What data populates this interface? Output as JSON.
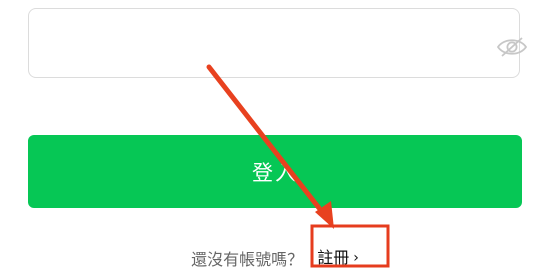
{
  "password": {
    "value": "",
    "visibility_icon": "eye-slash-icon"
  },
  "login": {
    "label": "登入",
    "color": "#06c755"
  },
  "signup": {
    "prompt": "還沒有帳號嗎？",
    "link_label": "註冊",
    "chevron": "›"
  },
  "annotation": {
    "color": "#e8411f",
    "box_color": "#e63c1e"
  }
}
